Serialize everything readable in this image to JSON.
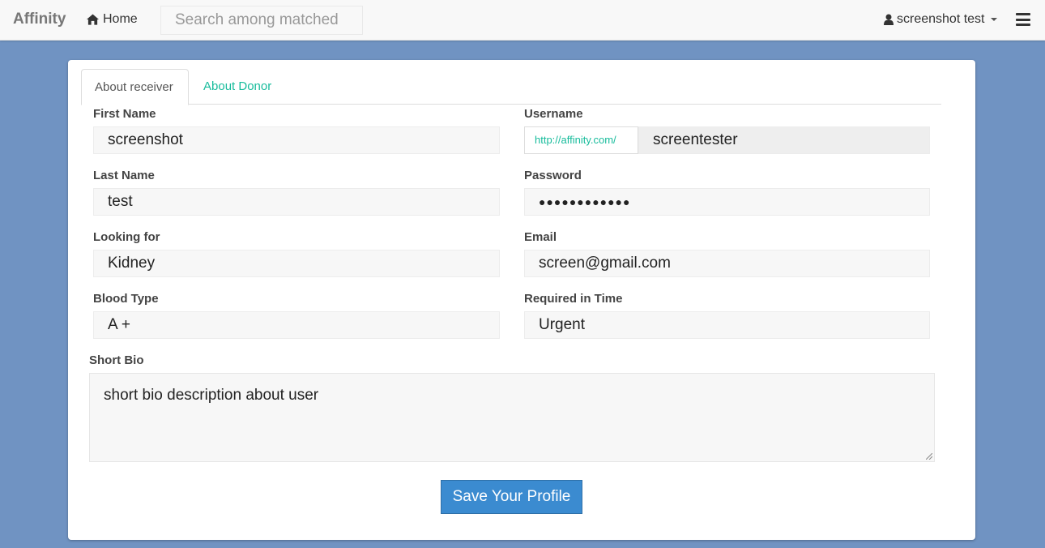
{
  "navbar": {
    "brand": "Affinity",
    "home_label": "Home",
    "search_placeholder": "Search among matched",
    "user_label": "screenshot test"
  },
  "tabs": [
    {
      "label": "About receiver",
      "active": true
    },
    {
      "label": "About Donor",
      "active": false
    }
  ],
  "form": {
    "first_name": {
      "label": "First Name",
      "value": "screenshot"
    },
    "last_name": {
      "label": "Last Name",
      "value": "test"
    },
    "looking_for": {
      "label": "Looking for",
      "value": "Kidney"
    },
    "blood_type": {
      "label": "Blood Type",
      "value": "A +"
    },
    "username": {
      "label": "Username",
      "prefix": "http://affinity.com/",
      "value": "screentester"
    },
    "password": {
      "label": "Password",
      "value": "●●●●●●●●●●●●"
    },
    "email": {
      "label": "Email",
      "value": "screen@gmail.com"
    },
    "required_in_time": {
      "label": "Required in Time",
      "value": "Urgent"
    },
    "short_bio": {
      "label": "Short Bio",
      "value": "short bio description about user"
    },
    "save_label": "Save Your Profile"
  },
  "colors": {
    "background": "#7093c2",
    "accent": "#18bc9c",
    "button": "#3b8bd0"
  }
}
